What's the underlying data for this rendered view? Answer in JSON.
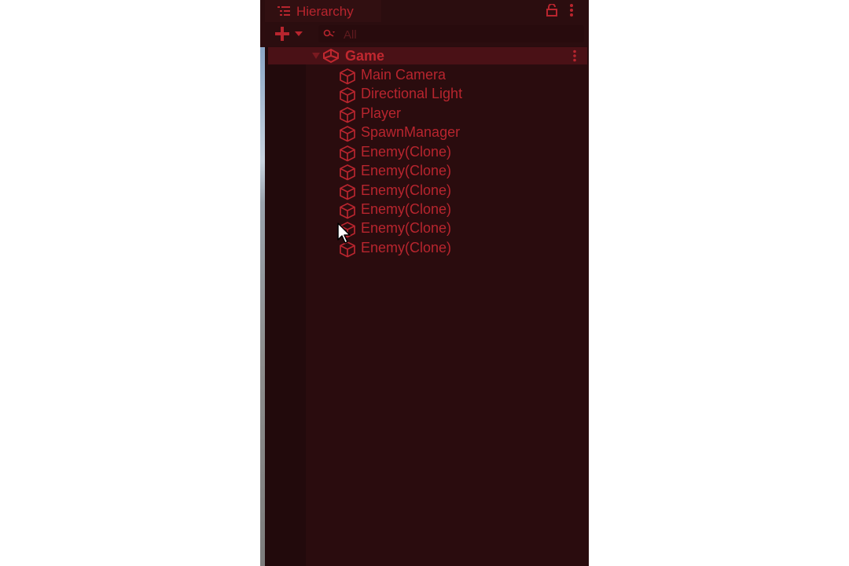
{
  "panel": {
    "tab_title": "Hierarchy",
    "tab_icon": "hierarchy-list-icon"
  },
  "toolbar": {
    "add_icon": "plus-dropdown-icon",
    "search_placeholder": "All",
    "search_value": ""
  },
  "scene": {
    "name": "Game",
    "expanded": true,
    "icon": "unity-scene-icon"
  },
  "items": [
    {
      "label": "Main Camera"
    },
    {
      "label": "Directional Light"
    },
    {
      "label": "Player"
    },
    {
      "label": "SpawnManager"
    },
    {
      "label": "Enemy(Clone)"
    },
    {
      "label": "Enemy(Clone)"
    },
    {
      "label": "Enemy(Clone)"
    },
    {
      "label": "Enemy(Clone)"
    },
    {
      "label": "Enemy(Clone)"
    },
    {
      "label": "Enemy(Clone)"
    }
  ],
  "colors": {
    "panel_bg": "#2a0c0e",
    "text": "#b8252e",
    "scene_row_bg": "#4a1116"
  }
}
